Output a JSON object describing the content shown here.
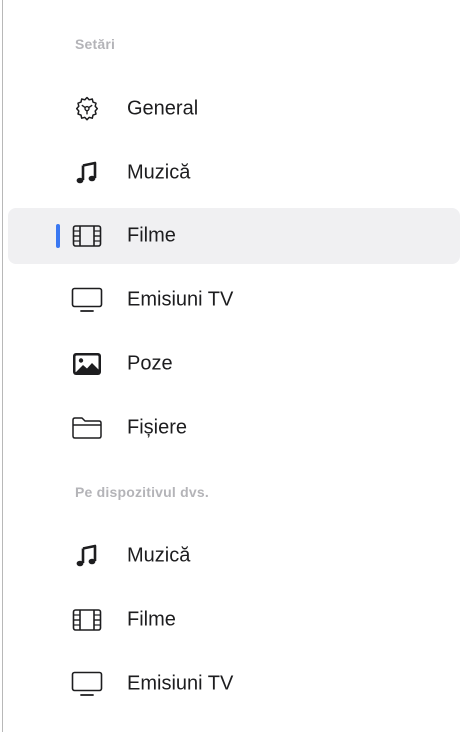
{
  "sections": [
    {
      "header": "Setări",
      "items": [
        {
          "label": "General",
          "icon": "gear-icon",
          "selected": false
        },
        {
          "label": "Muzică",
          "icon": "music-note-icon",
          "selected": false
        },
        {
          "label": "Filme",
          "icon": "film-icon",
          "selected": true
        },
        {
          "label": "Emisiuni TV",
          "icon": "tv-icon",
          "selected": false
        },
        {
          "label": "Poze",
          "icon": "photo-icon",
          "selected": false
        },
        {
          "label": "Fișiere",
          "icon": "folder-icon",
          "selected": false
        }
      ]
    },
    {
      "header": "Pe dispozitivul dvs.",
      "items": [
        {
          "label": "Muzică",
          "icon": "music-note-icon",
          "selected": false
        },
        {
          "label": "Filme",
          "icon": "film-icon",
          "selected": false
        },
        {
          "label": "Emisiuni TV",
          "icon": "tv-icon",
          "selected": false
        }
      ]
    }
  ],
  "colors": {
    "accent": "#3a78f2",
    "selected_bg": "#f0f0f2",
    "header_text": "#b4b4b8",
    "item_text": "#1d1d1f"
  }
}
